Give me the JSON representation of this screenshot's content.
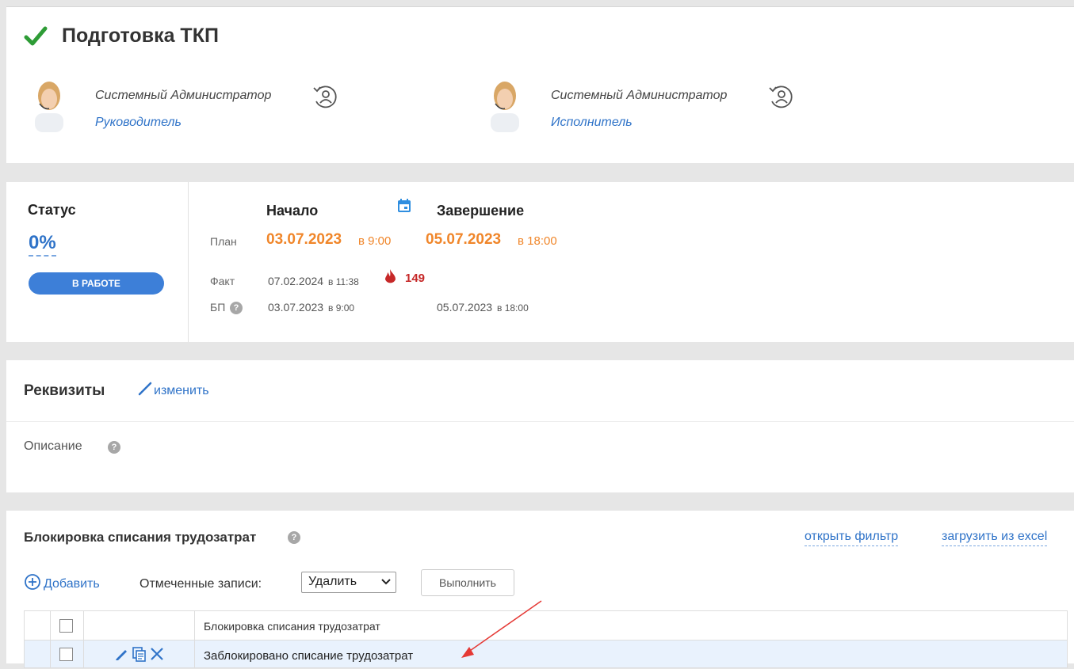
{
  "header": {
    "title": "Подготовка ТКП",
    "people": [
      {
        "name": "Системный Администратор",
        "role": "Руководитель"
      },
      {
        "name": "Системный Администратор",
        "role": "Исполнитель"
      }
    ]
  },
  "status": {
    "label": "Статус",
    "progress": "0%",
    "state": "В РАБОТЕ"
  },
  "dates": {
    "start_header": "Начало",
    "end_header": "Завершение",
    "plan": {
      "label": "План",
      "start_date": "03.07.2023",
      "start_time": "в 9:00",
      "end_date": "05.07.2023",
      "end_time": "в 18:00"
    },
    "fact": {
      "label": "Факт",
      "start_date": "07.02.2024",
      "start_time": "в 11:38",
      "overdue": "149"
    },
    "bp": {
      "label": "БП",
      "start_date": "03.07.2023",
      "start_time": "в 9:00",
      "end_date": "05.07.2023",
      "end_time": "в 18:00"
    }
  },
  "requisites": {
    "title": "Реквизиты",
    "edit_label": "изменить",
    "description_label": "Описание"
  },
  "block": {
    "title": "Блокировка списания трудозатрат",
    "open_filter": "открыть фильтр",
    "load_excel": "загрузить из excel",
    "add_label": "Добавить",
    "marked_label": "Отмеченные записи:",
    "action_selected": "Удалить",
    "execute_label": "Выполнить",
    "column_header": "Блокировка списания трудозатрат",
    "rows": [
      "Заблокировано списание трудозатрат"
    ]
  },
  "colors": {
    "accent": "#2f73c8",
    "plan_date": "#f0862a",
    "overdue": "#c62828",
    "check": "#2e9c36",
    "status_button": "#3d7fd8",
    "annotation_arrow": "#e53935"
  }
}
